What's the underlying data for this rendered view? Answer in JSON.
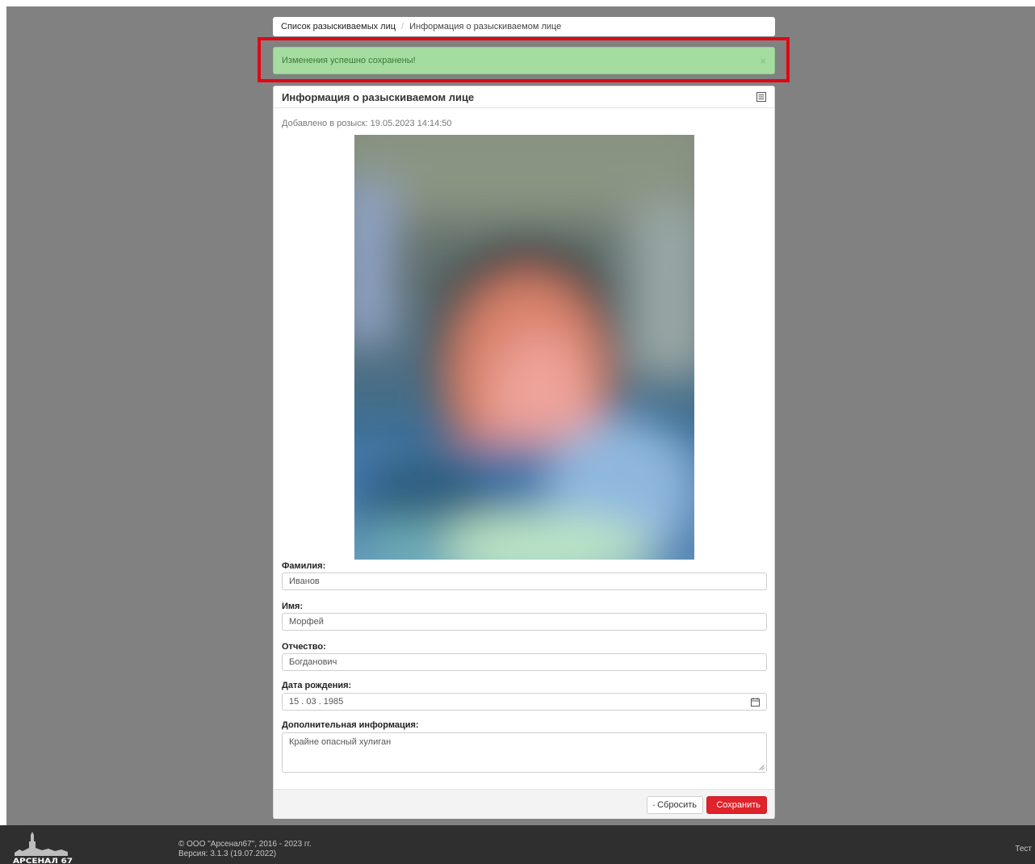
{
  "breadcrumb": {
    "root": "Список разыскиваемых лиц",
    "separator": "/",
    "current": "Информация о разыскиваемом лице"
  },
  "alert": {
    "message": "Изменения успешно сохранены!",
    "close": "×",
    "color": "#a5dc9f"
  },
  "card": {
    "title": "Информация о разыскиваемом лице",
    "title_icon": "list-icon",
    "added": "Добавлено в розыск: 19.05.2023 14:14:50",
    "photo": "blurred-person-photo"
  },
  "form": {
    "surname_label": "Фамилия:",
    "surname_value": "Иванов",
    "name_label": "Имя:",
    "name_value": "Морфей",
    "patronymic_label": "Отчество:",
    "patronymic_value": "Богданович",
    "birthdate_label": "Дата рождения:",
    "birthdate_value": "15 . 03 . 1985",
    "birthdate_icon": "calendar-icon",
    "info_label": "Дополнительная информация:",
    "info_value": "Крайне опасный хулиган"
  },
  "buttons": {
    "reset_label": "Сбросить",
    "reset_icon": "eraser-icon",
    "save_label": "Сохранить",
    "save_icon": "check-icon",
    "save_color": "#e0222a"
  },
  "footer": {
    "copyright": "© ООО \"Арсенал67\", 2016 - 2023 гг.",
    "version": "Версия: 3.1.3 (19.07.2022)",
    "right_text": "Тест",
    "logo_text": "АРСЕНАЛ 67"
  }
}
